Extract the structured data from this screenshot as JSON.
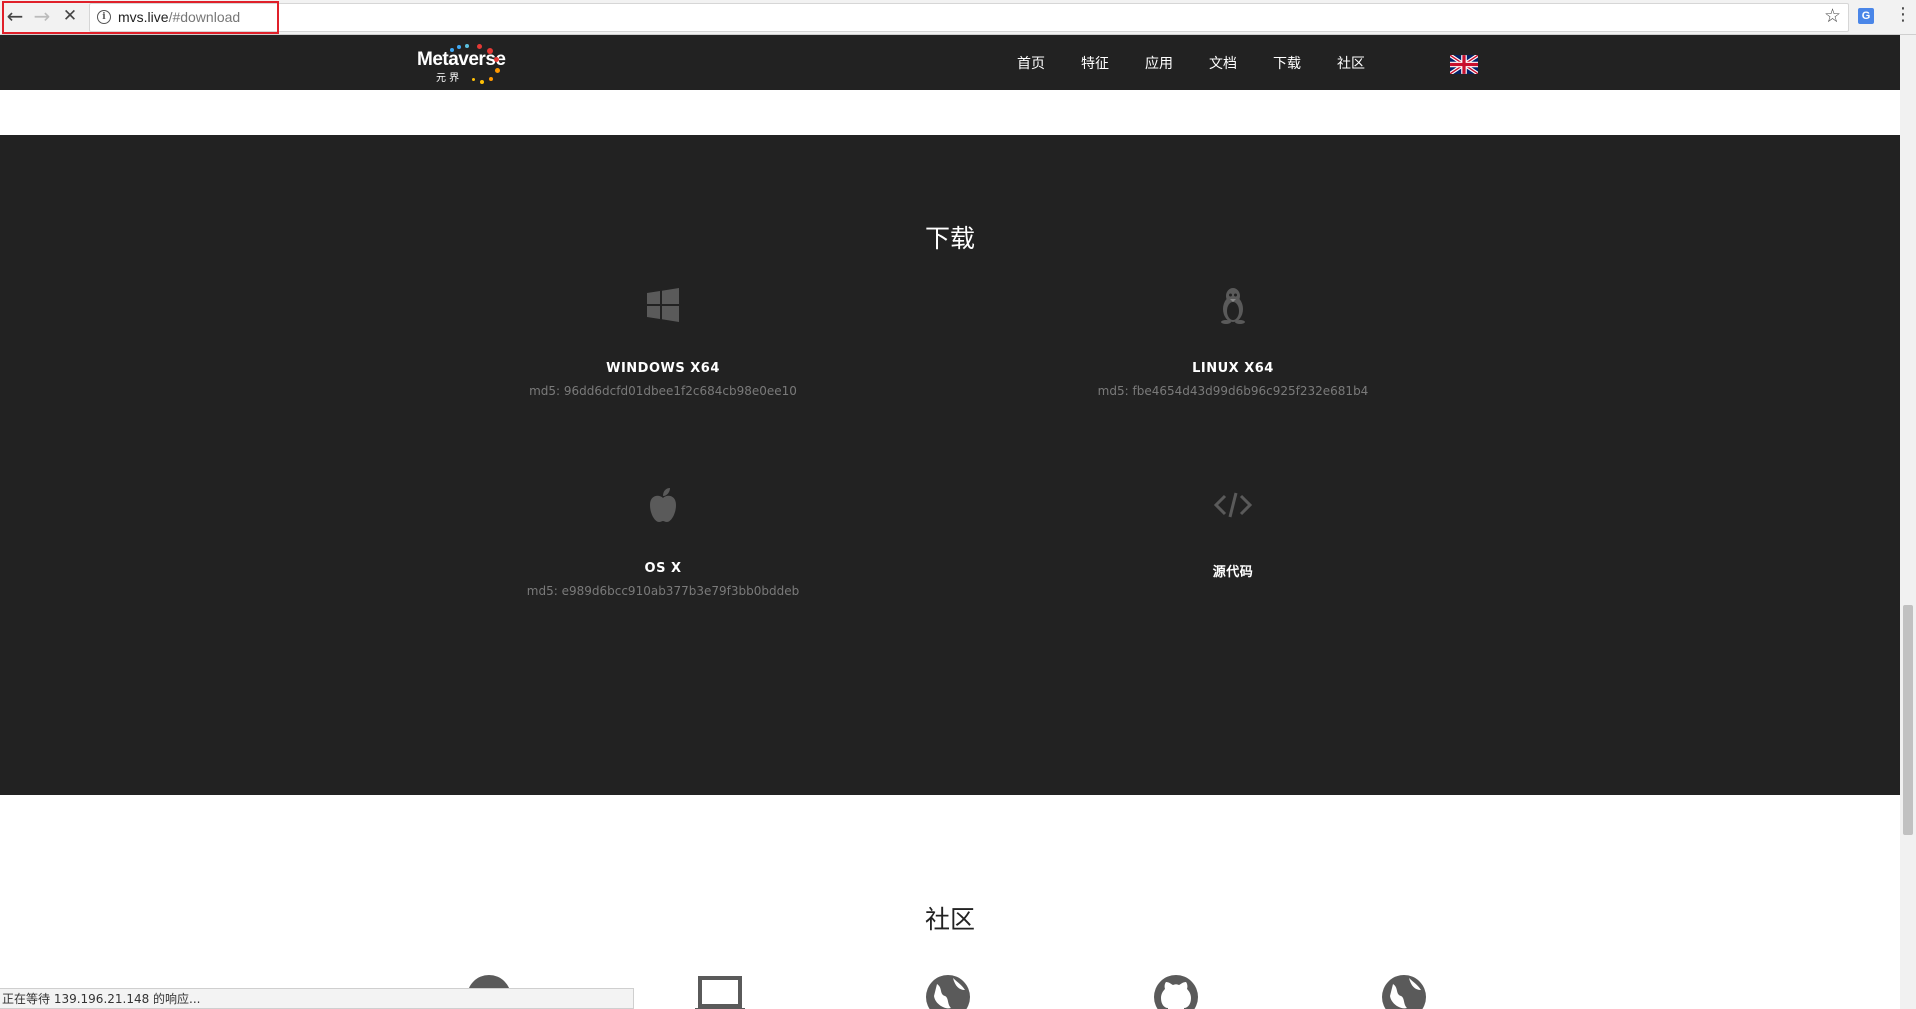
{
  "browser": {
    "url_host": "mvs.live",
    "url_path": "/#download",
    "back_icon": "back-arrow-icon",
    "forward_icon": "forward-arrow-icon",
    "stop_icon": "stop-loading-icon",
    "info_icon": "info-icon",
    "bookmark_icon": "star-icon",
    "translate_icon": "translate-icon",
    "menu_icon": "kebab-menu-icon",
    "status_text": "正在等待 139.196.21.148 的响应..."
  },
  "navbar": {
    "logo_text": "Metaverse",
    "logo_sub": "元 界",
    "items": [
      "首页",
      "特征",
      "应用",
      "文档",
      "下载",
      "社区"
    ],
    "language_flag_icon": "uk-flag-icon"
  },
  "download": {
    "title": "下载",
    "items": [
      {
        "name": "WINDOWS X64",
        "md5": "md5: 96dd6dcfd01dbee1f2c684cb98e0ee10",
        "icon": "windows-icon"
      },
      {
        "name": "LINUX X64",
        "md5": "md5: fbe4654d43d99d6b96c925f232e681b4",
        "icon": "linux-icon"
      },
      {
        "name": "OS X",
        "md5": "md5: e989d6bcc910ab377b3e79f3bb0bddeb",
        "icon": "apple-icon"
      },
      {
        "name": "源代码",
        "md5": "",
        "icon": "code-icon"
      }
    ]
  },
  "community": {
    "title": "社区",
    "icons": [
      "community-icon-1",
      "laptop-icon",
      "globe-icon",
      "github-icon",
      "globe-icon-2"
    ]
  },
  "colors": {
    "navbar_bg": "#222222",
    "section_bg": "#222222",
    "highlight": "#e0202a",
    "icon_gray": "#5a5a5a"
  }
}
